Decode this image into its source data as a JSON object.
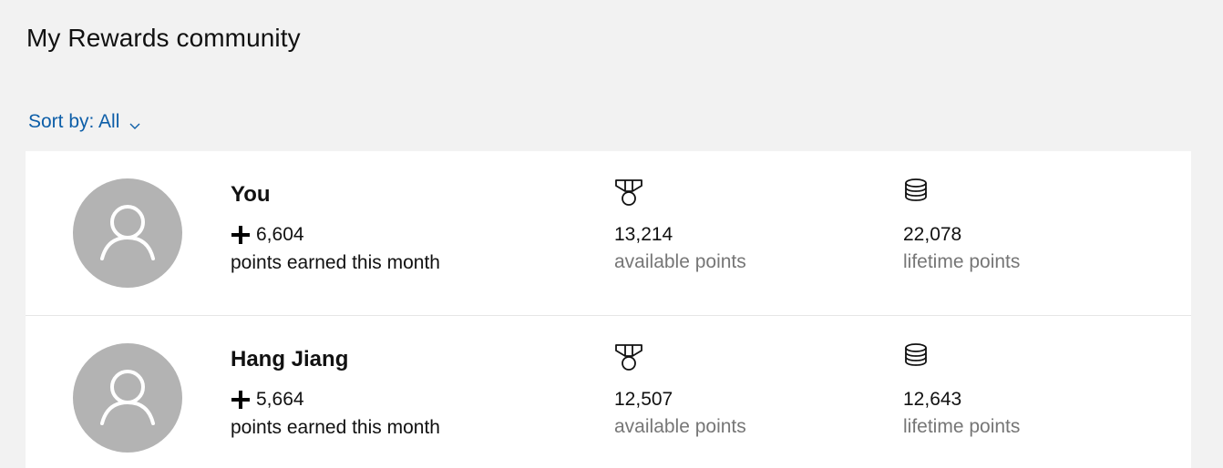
{
  "header": {
    "title": "My Rewards community"
  },
  "sort": {
    "label": "Sort by: All",
    "icon": "chevron-down-icon"
  },
  "members": [
    {
      "name": "You",
      "earned": "6,604",
      "earned_label": "points earned this month",
      "available": "13,214",
      "available_label": "available points",
      "lifetime": "22,078",
      "lifetime_label": "lifetime points"
    },
    {
      "name": "Hang Jiang",
      "earned": "5,664",
      "earned_label": "points earned this month",
      "available": "12,507",
      "available_label": "available points",
      "lifetime": "12,643",
      "lifetime_label": "lifetime points"
    }
  ],
  "icons": {
    "avatar": "person-icon",
    "earned": "plus-icon",
    "available": "medal-icon",
    "lifetime": "coins-stack-icon"
  },
  "colors": {
    "background": "#f2f2f2",
    "card": "#ffffff",
    "link": "#0d5ea8",
    "avatar": "#b3b3b3",
    "muted_text": "#767676"
  }
}
